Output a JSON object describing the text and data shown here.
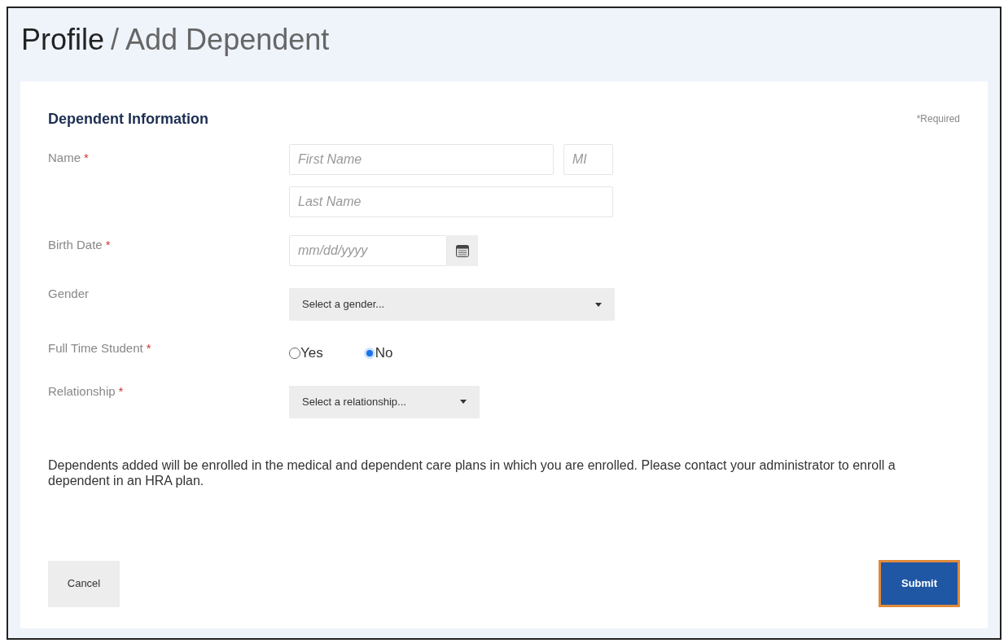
{
  "page_title": {
    "current": "Profile",
    "sub": "/ Add Dependent"
  },
  "section": {
    "title": "Dependent Information",
    "required_note": "*Required"
  },
  "fields": [
    {
      "kind": "name",
      "label": "Name",
      "required_mark": "*",
      "inputs": [
        {
          "placeholder": "First Name"
        },
        {
          "placeholder": "MI"
        },
        {
          "placeholder": "Last Name"
        }
      ]
    },
    {
      "kind": "date",
      "label": "Birth Date",
      "required_mark": "*",
      "placeholder": "mm/dd/yyyy"
    },
    {
      "kind": "select",
      "label": "Gender",
      "value": "Select a gender...",
      "wide": true
    },
    {
      "kind": "radio",
      "label": "Full Time Student",
      "required_mark": "*",
      "options": [
        {
          "label": "Yes",
          "selected": false
        },
        {
          "label": "No",
          "selected": true
        }
      ]
    },
    {
      "kind": "select",
      "label": "Relationship",
      "required_mark": "*",
      "value": "Select a relationship...",
      "wide": false
    }
  ],
  "notice": "Dependents added will be enrolled in the medical and dependent care plans in which you are enrolled. Please contact your administrator to enroll a dependent in an HRA plan.",
  "buttons": [
    {
      "kind": "secondary",
      "label": "Cancel"
    },
    {
      "kind": "primary",
      "label": "Submit"
    }
  ]
}
